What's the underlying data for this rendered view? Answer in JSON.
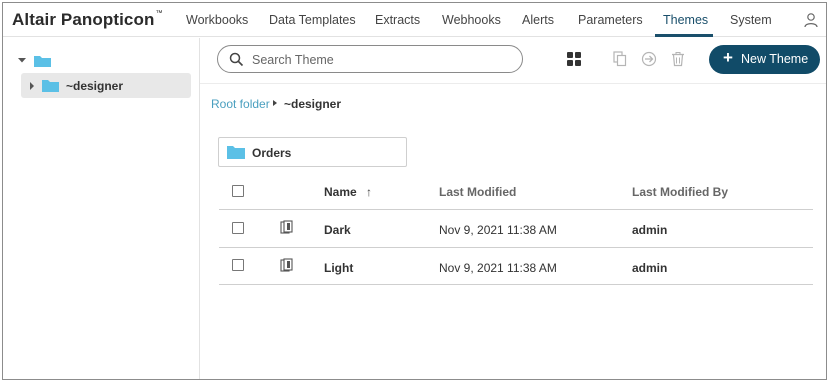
{
  "app": {
    "brand_name": "Altair Panopticon",
    "brand_mark": "™"
  },
  "nav": {
    "items": [
      {
        "label": "Workbooks"
      },
      {
        "label": "Data Templates"
      },
      {
        "label": "Extracts"
      },
      {
        "label": "Webhooks"
      },
      {
        "label": "Alerts"
      },
      {
        "label": "Parameters"
      },
      {
        "label": "Themes",
        "active": true
      },
      {
        "label": "System"
      }
    ],
    "user_icon": "user-icon"
  },
  "tree": {
    "root_icon": "folder-icon",
    "items": [
      {
        "label": "~designer",
        "selected": true
      }
    ]
  },
  "toolbar": {
    "search_placeholder": "Search Theme",
    "search_value": "",
    "icons": [
      "grid-view-icon",
      "copy-icon",
      "move-icon",
      "trash-icon"
    ],
    "new_button_label": "New Theme"
  },
  "breadcrumb": {
    "root": "Root folder",
    "current": "~designer"
  },
  "folders": [
    {
      "label": "Orders"
    }
  ],
  "table": {
    "columns": {
      "name": "Name",
      "sort_icon": "↑",
      "modified": "Last Modified",
      "modified_by": "Last Modified By"
    },
    "rows": [
      {
        "name": "Dark",
        "modified": "Nov 9, 2021 11:38 AM",
        "modified_by": "admin"
      },
      {
        "name": "Light",
        "modified": "Nov 9, 2021 11:38 AM",
        "modified_by": "admin"
      }
    ]
  },
  "colors": {
    "accent": "#114b68",
    "link": "#4a9fbf",
    "folder": "#5bc0e6"
  }
}
